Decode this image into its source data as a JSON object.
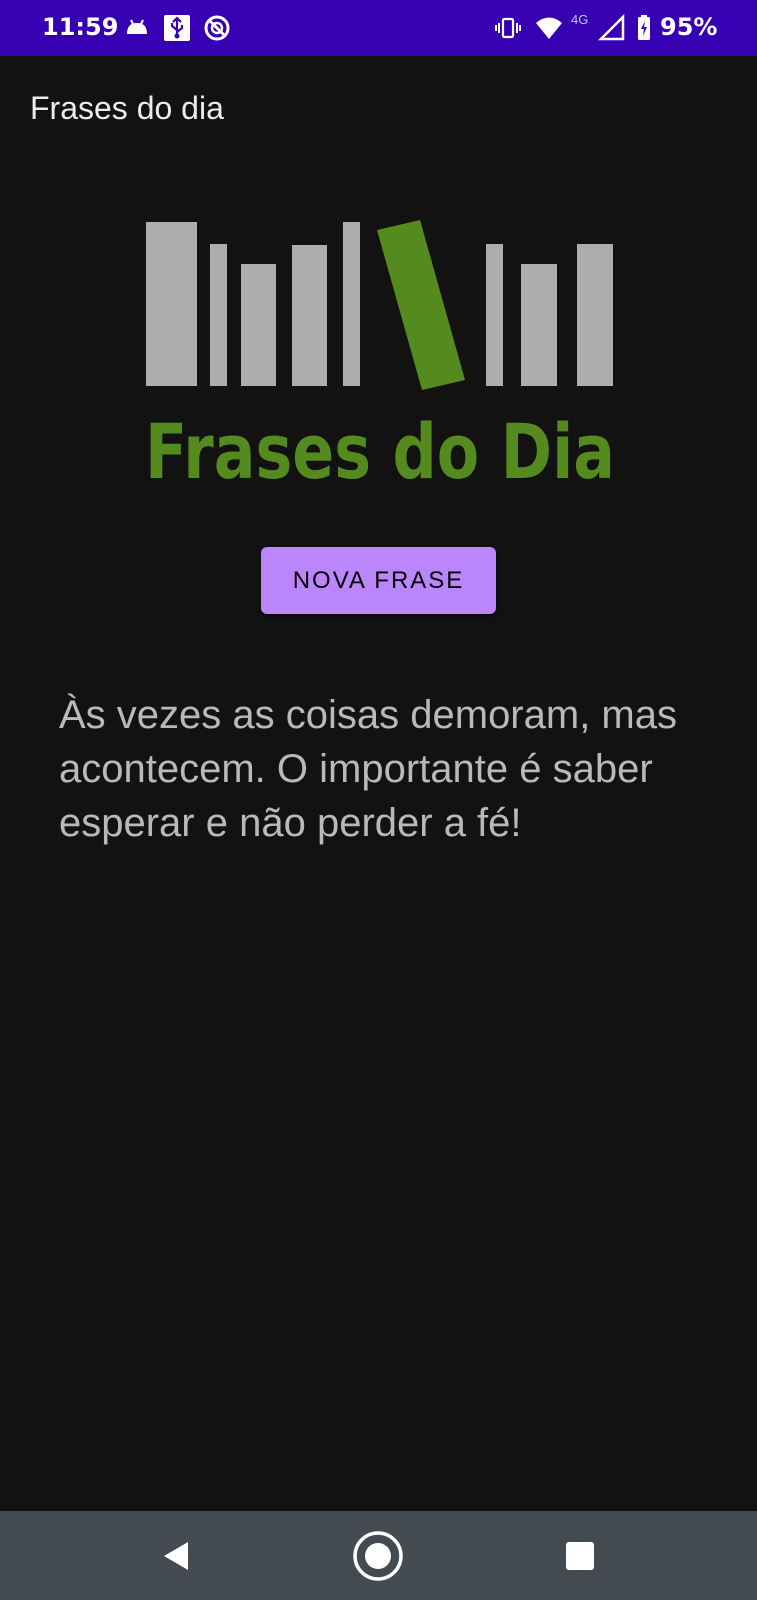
{
  "status_bar": {
    "time": "11:59",
    "network": "4G",
    "battery": "95%",
    "background_color": "#3700b3",
    "icons": [
      "android-icon",
      "usb-debug-icon",
      "do-not-disturb-icon",
      "vibrate-icon",
      "wifi-icon",
      "signal-icon",
      "battery-charging-icon"
    ]
  },
  "app_bar": {
    "title": "Frases do dia"
  },
  "logo": {
    "text": "Frases do Dia",
    "accent_color": "#558b1e",
    "bar_color": "#adadad"
  },
  "main": {
    "button_label": "NOVA FRASE",
    "button_color": "#bb86fc",
    "quote": "Às vezes as coisas demoram, mas acontecem. O importante é saber esperar e não perder a fé!"
  },
  "nav_bar": {
    "buttons": [
      "back-icon",
      "home-icon",
      "recents-icon"
    ]
  }
}
